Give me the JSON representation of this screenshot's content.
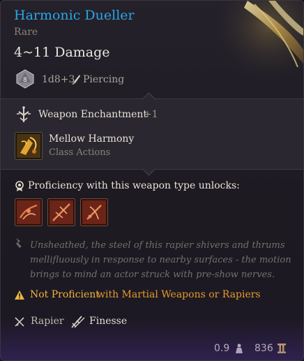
{
  "item": {
    "name": "Harmonic Dueller",
    "rarity": "Rare",
    "damage": "4~11 Damage",
    "damage_die_icon_value": "8",
    "damage_dice": "1d8+3",
    "damage_type": "Piercing"
  },
  "enchantment": {
    "title": "Weapon Enchantment",
    "bonus": "+1",
    "action_name": "Mellow Harmony",
    "action_category": "Class Actions"
  },
  "proficiency": {
    "text": "Proficiency with this weapon type unlocks:",
    "unlock_icons": [
      "flourish-action-icon",
      "slash-action-icon",
      "piercing-strike-action-icon"
    ]
  },
  "lore": "Unsheathed, the steel of this rapier shivers and thrums mellifluously in response to nearby surfaces - the motion brings to mind an actor struck with pre-show nerves.",
  "warning": {
    "not_proficient": "Not Proficient",
    "rest": "with Martial Weapons or Rapiers"
  },
  "properties": [
    "Rapier",
    "Finesse"
  ],
  "footer": {
    "weight": "0.9",
    "price": "836"
  },
  "colors": {
    "name": "#2aa6e6",
    "warning": "#f0b43a",
    "accent_bronze": "#c8742e"
  }
}
